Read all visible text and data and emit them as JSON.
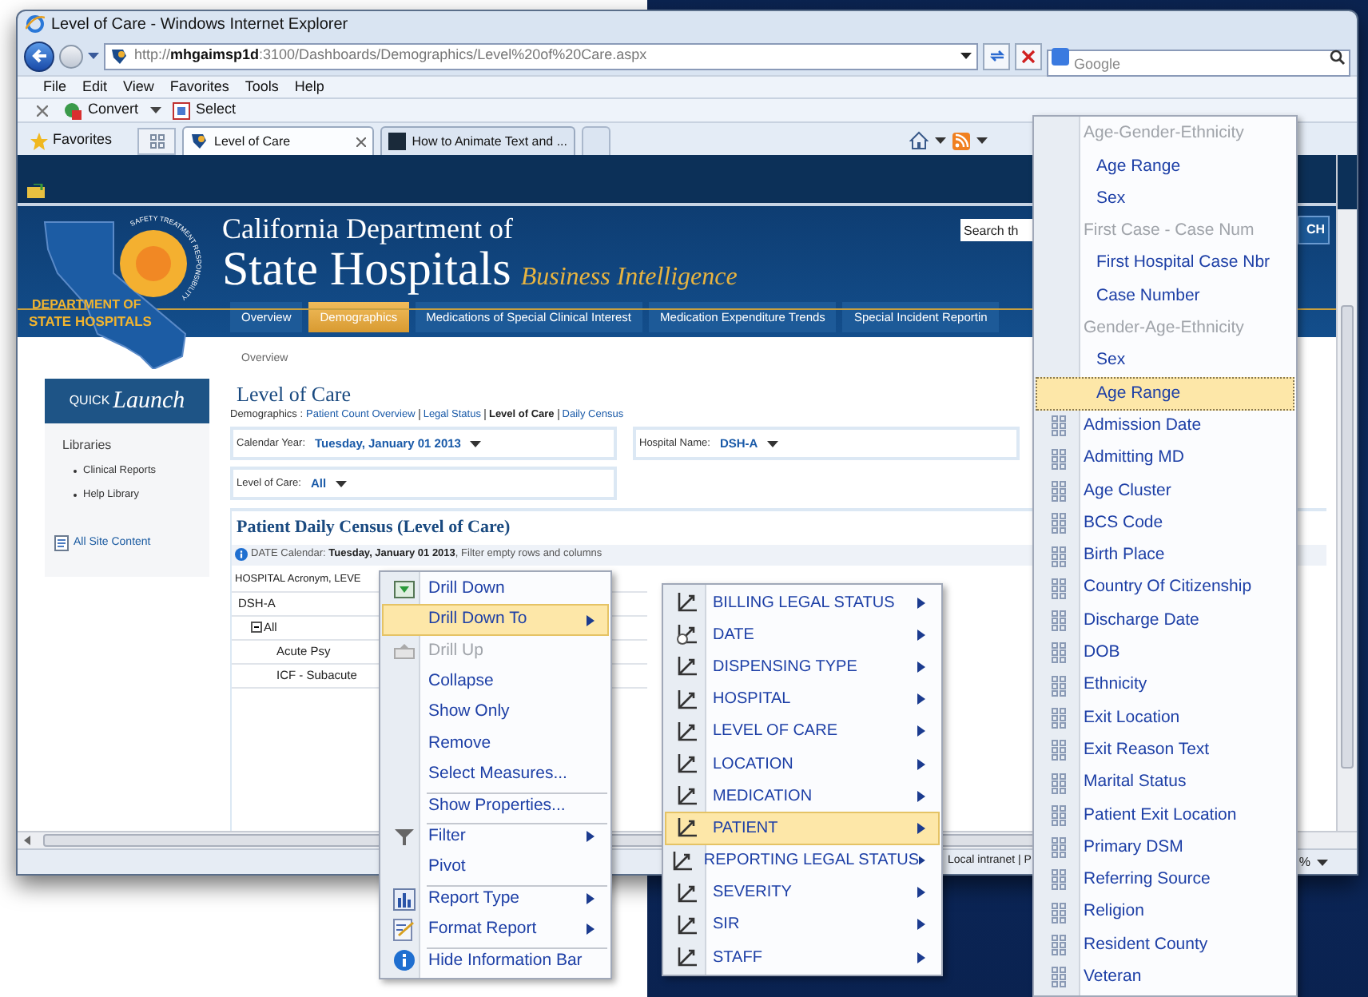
{
  "window": {
    "title": "Level of Care - Windows Internet Explorer"
  },
  "address_bar": {
    "url": "http://**mhgaimsp1d**:3100/Dashboards/Demographics/Level%20of%20Care.aspx",
    "search_placeholder": "Google"
  },
  "menu_bar": [
    "File",
    "Edit",
    "View",
    "Favorites",
    "Tools",
    "Help"
  ],
  "command_bar": {
    "convert": "Convert",
    "select": "Select"
  },
  "favorites_bar": {
    "label": "Favorites",
    "tabs": [
      {
        "label": "Level of Care",
        "selected": true
      },
      {
        "label": "How to Animate Text and ...",
        "selected": false
      }
    ]
  },
  "site": {
    "logo_arc": "SAFETY TREATMENT RESPONSIBILITY",
    "logo_line1": "DEPARTMENT OF",
    "logo_line2": "STATE HOSPITALS",
    "title_line1": "California Department of",
    "title_line2": "State Hospitals",
    "subtitle": "Business Intelligence",
    "search_placeholder": "Search th",
    "search_button": "CH",
    "nav": [
      {
        "label": "Overview",
        "selected": false
      },
      {
        "label": "Demographics",
        "selected": true
      },
      {
        "label": "Medications of Special Clinical Interest",
        "selected": false
      },
      {
        "label": "Medication Expenditure Trends",
        "selected": false
      },
      {
        "label": "Special Incident Reportin",
        "selected": false
      }
    ]
  },
  "breadcrumb": "Overview",
  "quick_launch": {
    "title_small": "QUICK",
    "title_big": "Launch",
    "heading": "Libraries",
    "items": [
      "Clinical Reports",
      "Help Library"
    ],
    "all_site_content": "All Site Content"
  },
  "page": {
    "title": "Level of Care",
    "crumb_label": "Demographics :",
    "links": [
      {
        "label": "Patient Count Overview",
        "selected": false
      },
      {
        "label": "Legal Status",
        "selected": false
      },
      {
        "label": "Level of Care",
        "selected": true
      },
      {
        "label": "Daily Census",
        "selected": false
      }
    ]
  },
  "filters": [
    {
      "label": "Calendar Year:",
      "value": "Tuesday, January 01 2013"
    },
    {
      "label": "Hospital Name:",
      "value": "DSH-A"
    },
    {
      "label": "Level of Care:",
      "value": "All"
    }
  ],
  "report": {
    "title": "Patient Daily Census (Level of Care)",
    "info": "DATE Calendar: **Tuesday, January 01 2013**, Filter empty rows and columns",
    "column_header": "HOSPITAL Acronym, LEVE",
    "rows": [
      {
        "label": "DSH-A",
        "children": [
          {
            "label": "All",
            "expanded": true,
            "children": [
              {
                "label": "Acute Psy"
              },
              {
                "label": "ICF - Subacute"
              }
            ]
          }
        ]
      }
    ]
  },
  "status_bar": {
    "zone": "Local intranet | P",
    "zoom": "%"
  },
  "context_menu": {
    "items": [
      {
        "label": "Drill Down",
        "kind": "drill-down",
        "submenu": false,
        "selected": false,
        "disabled": false,
        "separator_before": false
      },
      {
        "label": "Drill Down To",
        "kind": "plain",
        "submenu": true,
        "selected": true,
        "disabled": false,
        "separator_before": false
      },
      {
        "label": "Drill Up",
        "kind": "drill-up",
        "submenu": false,
        "selected": false,
        "disabled": true,
        "separator_before": false
      },
      {
        "label": "Collapse",
        "kind": "plain",
        "submenu": false,
        "selected": false,
        "disabled": false,
        "separator_before": false
      },
      {
        "label": "Show Only",
        "kind": "plain",
        "submenu": false,
        "selected": false,
        "disabled": false,
        "separator_before": false
      },
      {
        "label": "Remove",
        "kind": "plain",
        "submenu": false,
        "selected": false,
        "disabled": false,
        "separator_before": false
      },
      {
        "label": "Select Measures...",
        "kind": "plain",
        "submenu": false,
        "selected": false,
        "disabled": false,
        "separator_before": false
      },
      {
        "label": "Show Properties...",
        "kind": "plain",
        "submenu": false,
        "selected": false,
        "disabled": false,
        "separator_before": true
      },
      {
        "label": "Filter",
        "kind": "filter",
        "submenu": true,
        "selected": false,
        "disabled": false,
        "separator_before": true
      },
      {
        "label": "Pivot",
        "kind": "plain",
        "submenu": false,
        "selected": false,
        "disabled": false,
        "separator_before": false
      },
      {
        "label": "Report Type",
        "kind": "chart",
        "submenu": true,
        "selected": false,
        "disabled": false,
        "separator_before": true
      },
      {
        "label": "Format Report",
        "kind": "format",
        "submenu": true,
        "selected": false,
        "disabled": false,
        "separator_before": false
      },
      {
        "label": "Hide Information Bar",
        "kind": "info",
        "submenu": false,
        "selected": false,
        "disabled": false,
        "separator_before": true
      }
    ]
  },
  "drill_submenu": {
    "items": [
      {
        "label": "BILLING LEGAL STATUS",
        "kind": "dimension",
        "selected": false
      },
      {
        "label": "DATE",
        "kind": "time",
        "selected": false
      },
      {
        "label": "DISPENSING TYPE",
        "kind": "dimension",
        "selected": false
      },
      {
        "label": "HOSPITAL",
        "kind": "dimension",
        "selected": false
      },
      {
        "label": "LEVEL OF CARE",
        "kind": "dimension",
        "selected": false
      },
      {
        "label": "LOCATION",
        "kind": "dimension",
        "selected": false
      },
      {
        "label": "MEDICATION",
        "kind": "dimension",
        "selected": false
      },
      {
        "label": "PATIENT",
        "kind": "dimension",
        "selected": true
      },
      {
        "label": "REPORTING LEGAL STATUS",
        "kind": "dimension",
        "selected": false
      },
      {
        "label": "SEVERITY",
        "kind": "dimension",
        "selected": false
      },
      {
        "label": "SIR",
        "kind": "dimension",
        "selected": false
      },
      {
        "label": "STAFF",
        "kind": "dimension",
        "selected": false
      }
    ]
  },
  "attribute_submenu": {
    "items": [
      {
        "label": "Age-Gender-Ethnicity",
        "kind": "hierarchy",
        "selected": false
      },
      {
        "label": "Age Range",
        "kind": "level",
        "selected": false
      },
      {
        "label": "Sex",
        "kind": "level",
        "selected": false
      },
      {
        "label": "First Case - Case Num",
        "kind": "hierarchy",
        "selected": false
      },
      {
        "label": "First Hospital Case Nbr",
        "kind": "level",
        "selected": false
      },
      {
        "label": "Case Number",
        "kind": "level",
        "selected": false
      },
      {
        "label": "Gender-Age-Ethnicity",
        "kind": "hierarchy",
        "selected": false
      },
      {
        "label": "Sex",
        "kind": "level",
        "selected": false
      },
      {
        "label": "Age Range",
        "kind": "level",
        "selected": true
      },
      {
        "label": "Admission Date",
        "kind": "attribute",
        "selected": false
      },
      {
        "label": "Admitting MD",
        "kind": "attribute",
        "selected": false
      },
      {
        "label": "Age Cluster",
        "kind": "attribute",
        "selected": false
      },
      {
        "label": "BCS Code",
        "kind": "attribute",
        "selected": false
      },
      {
        "label": "Birth Place",
        "kind": "attribute",
        "selected": false
      },
      {
        "label": "Country Of Citizenship",
        "kind": "attribute",
        "selected": false
      },
      {
        "label": "Discharge Date",
        "kind": "attribute",
        "selected": false
      },
      {
        "label": "DOB",
        "kind": "attribute",
        "selected": false
      },
      {
        "label": "Ethnicity",
        "kind": "attribute",
        "selected": false
      },
      {
        "label": "Exit Location",
        "kind": "attribute",
        "selected": false
      },
      {
        "label": "Exit Reason Text",
        "kind": "attribute",
        "selected": false
      },
      {
        "label": "Marital Status",
        "kind": "attribute",
        "selected": false
      },
      {
        "label": "Patient Exit Location",
        "kind": "attribute",
        "selected": false
      },
      {
        "label": "Primary DSM",
        "kind": "attribute",
        "selected": false
      },
      {
        "label": "Referring Source",
        "kind": "attribute",
        "selected": false
      },
      {
        "label": "Religion",
        "kind": "attribute",
        "selected": false
      },
      {
        "label": "Resident County",
        "kind": "attribute",
        "selected": false
      },
      {
        "label": "Veteran",
        "kind": "attribute",
        "selected": false
      }
    ]
  }
}
